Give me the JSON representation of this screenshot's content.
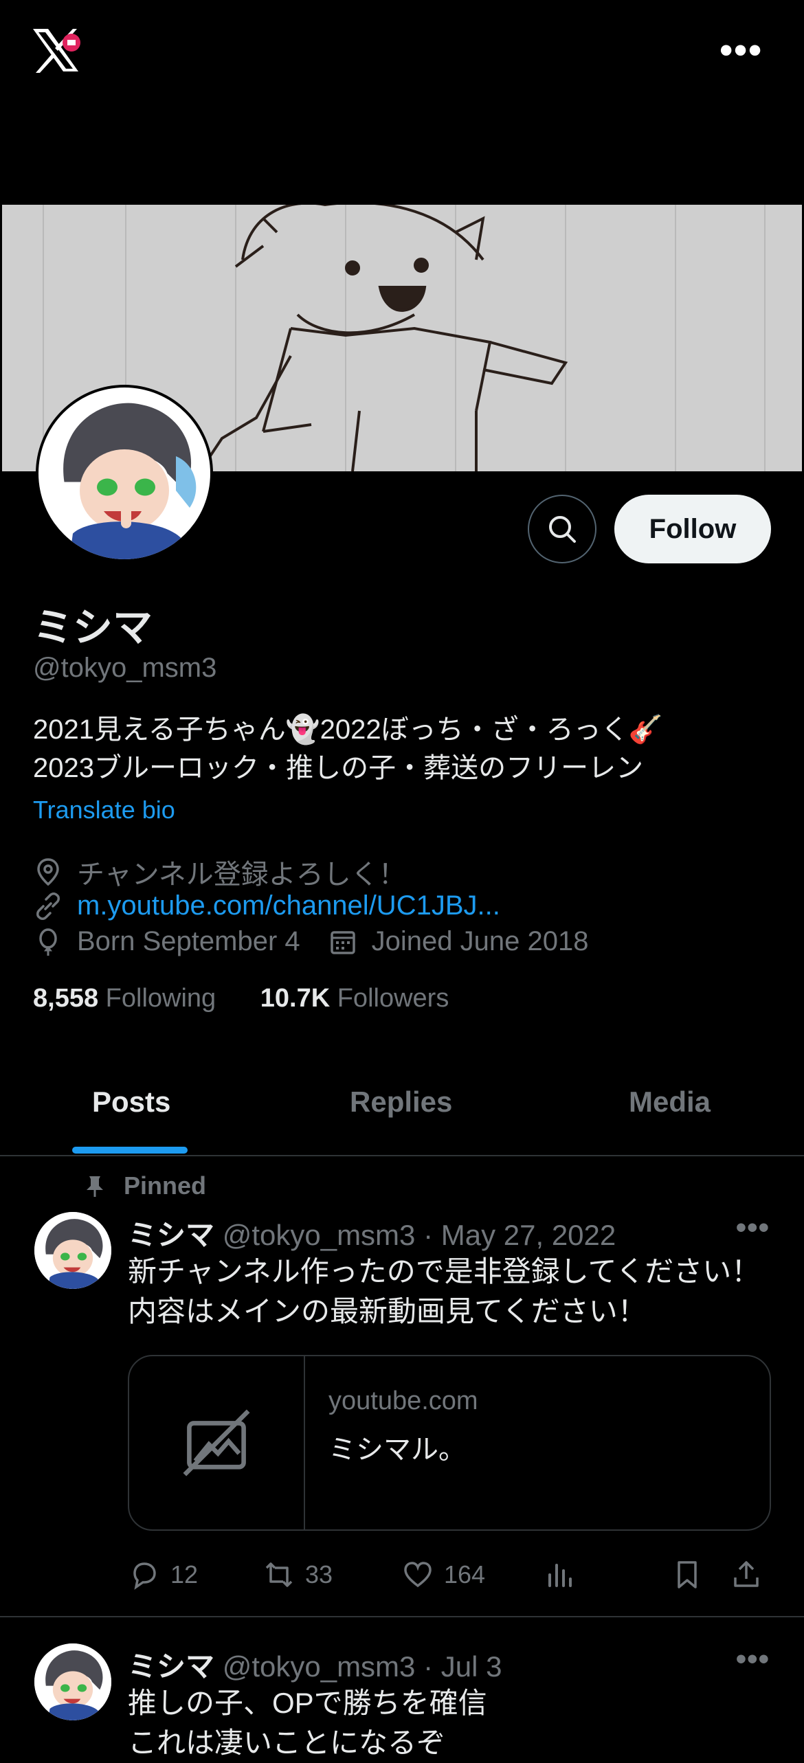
{
  "topbar": {
    "logo_icon": "x-logo-icon",
    "more_icon": "more-horizontal-icon",
    "more_label": "•••"
  },
  "profile": {
    "display_name": "ミシマ",
    "handle": "@tokyo_msm3",
    "bio_line1": "2021見える子ちゃん👻2022ぼっち・ざ・ろっく🎸",
    "bio_line2": "2023ブルーロック・推しの子・葬送のフリーレン",
    "translate_label": "Translate bio",
    "location": "チャンネル登録よろしく！",
    "website": "m.youtube.com/channel/UC1JBJ...",
    "birthday": "Born September 4",
    "joined": "Joined June 2018",
    "following_count": "8,558",
    "following_label": "Following",
    "followers_count": "10.7K",
    "followers_label": "Followers",
    "follow_button": "Follow"
  },
  "tabs": [
    {
      "label": "Posts",
      "active": true
    },
    {
      "label": "Replies",
      "active": false
    },
    {
      "label": "Media",
      "active": false
    }
  ],
  "posts": [
    {
      "pinned_label": "Pinned",
      "name": "ミシマ",
      "handle": "@tokyo_msm3",
      "separator": "·",
      "date": "May 27, 2022",
      "text_line1": "新チャンネル作ったので是非登録してください！",
      "text_line2": "内容はメインの最新動画見てください！",
      "card": {
        "domain": "youtube.com",
        "title": "ミシマル。"
      },
      "replies": "12",
      "reposts": "33",
      "likes": "164"
    },
    {
      "name": "ミシマ",
      "handle": "@tokyo_msm3",
      "separator": "·",
      "date": "Jul 3",
      "text_line1": "推しの子、OPで勝ちを確信",
      "text_line2": "これは凄いことになるぞ"
    }
  ],
  "colors": {
    "accent": "#1d9bf0",
    "background": "#000000",
    "muted": "#71767b",
    "text": "#e7e9ea"
  }
}
